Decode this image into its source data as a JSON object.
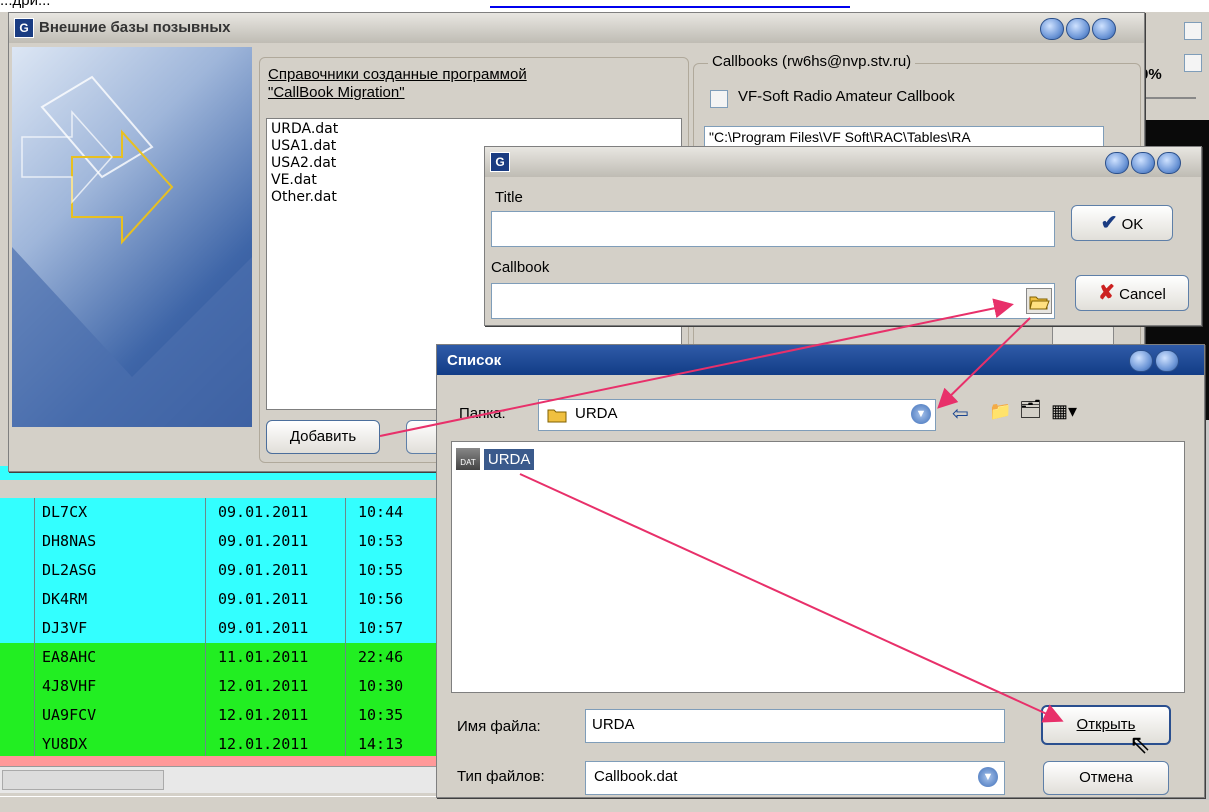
{
  "top_strip": {
    "text": "...дрй..."
  },
  "main_dialog": {
    "title": "Внешние базы позывных",
    "list_header_line1": "Справочники созданные программой",
    "list_header_line2": "\"CallBook Migration\"",
    "list_items": [
      "URDA.dat",
      "USA1.dat",
      "USA2.dat",
      "VE.dat",
      "Other.dat"
    ],
    "add_button": "Добавить",
    "callbooks_group_label": "Callbooks (rw6hs@nvp.stv.ru)",
    "vf_checkbox_label": "VF-Soft Radio Amateur Callbook",
    "vf_path": "\"C:\\Program Files\\VF Soft\\RAC\\Tables\\RA",
    "percent": "0%"
  },
  "callbook_dialog": {
    "title_label": "Title",
    "title_value": "",
    "callbook_label": "Callbook",
    "callbook_value": "",
    "ok_button": "OK",
    "cancel_button": "Cancel"
  },
  "open_dialog": {
    "title": "Список",
    "folder_label": "Папка:",
    "folder_value": "URDA",
    "file_item": "URDA",
    "file_icon_caption": "DAT",
    "filename_label": "Имя файла:",
    "filename_value": "URDA",
    "filetype_label": "Тип файлов:",
    "filetype_value": "Callbook.dat",
    "open_button": "Открыть",
    "cancel_button": "Отмена"
  },
  "log_rows": [
    {
      "call": "DL7CX",
      "date": "09.01.2011",
      "time": "10:44",
      "color": "#33ffff"
    },
    {
      "call": "DH8NAS",
      "date": "09.01.2011",
      "time": "10:53",
      "color": "#33ffff"
    },
    {
      "call": "DL2ASG",
      "date": "09.01.2011",
      "time": "10:55",
      "color": "#33ffff"
    },
    {
      "call": "DK4RM",
      "date": "09.01.2011",
      "time": "10:56",
      "color": "#33ffff"
    },
    {
      "call": "DJ3VF",
      "date": "09.01.2011",
      "time": "10:57",
      "color": "#33ffff"
    },
    {
      "call": "EA8AHC",
      "date": "11.01.2011",
      "time": "22:46",
      "color": "#22ee22"
    },
    {
      "call": "4J8VHF",
      "date": "12.01.2011",
      "time": "10:30",
      "color": "#22ee22"
    },
    {
      "call": "UA9FCV",
      "date": "12.01.2011",
      "time": "10:35",
      "color": "#22ee22"
    },
    {
      "call": "YU8DX",
      "date": "12.01.2011",
      "time": "14:13",
      "color": "#22ee22"
    }
  ],
  "colors": {
    "cyan_row": "#33ffff",
    "green_row": "#22ee22",
    "arrow": "#e8306a",
    "title_blue": "#1a4590",
    "selection": "#3a5a8c"
  }
}
